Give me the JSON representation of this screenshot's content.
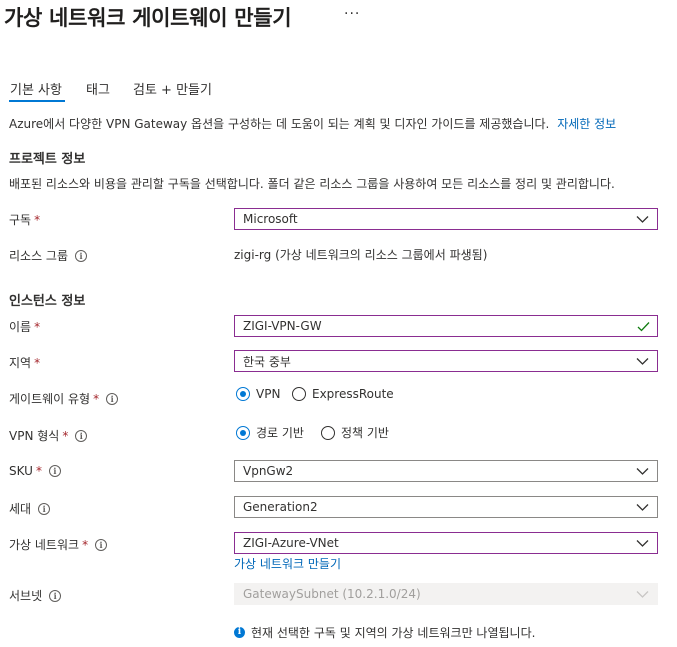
{
  "page": {
    "title": "가상 네트워크 게이트웨이 만들기",
    "more": "···"
  },
  "tabs": [
    {
      "label": "기본 사항",
      "selected": true
    },
    {
      "label": "태그",
      "selected": false
    },
    {
      "label": "검토 + 만들기",
      "selected": false
    }
  ],
  "description": {
    "text": "Azure에서 다양한 VPN Gateway 옵션을 구성하는 데 도움이 되는 계획 및 디자인 가이드를 제공했습니다.",
    "link": "자세한 정보"
  },
  "project": {
    "heading": "프로젝트 정보",
    "description": "배포된 리소스와 비용을 관리할 구독을 선택합니다. 폴더 같은 리소스 그룹을 사용하여 모든 리소스를 정리 및 관리합니다.",
    "subscription": {
      "label": "구독",
      "value": "Microsoft"
    },
    "resource_group": {
      "label": "리소스 그룹",
      "value": "zigi-rg (가상 네트워크의 리소스 그룹에서 파생됨)"
    }
  },
  "instance": {
    "heading": "인스턴스 정보",
    "name": {
      "label": "이름",
      "value": "ZIGI-VPN-GW"
    },
    "region": {
      "label": "지역",
      "value": "한국 중부"
    },
    "gateway_type": {
      "label": "게이트웨이 유형",
      "options": [
        "VPN",
        "ExpressRoute"
      ],
      "selected": "VPN"
    },
    "vpn_type": {
      "label": "VPN 형식",
      "options": [
        "경로 기반",
        "정책 기반"
      ],
      "selected": "경로 기반"
    },
    "sku": {
      "label": "SKU",
      "value": "VpnGw2"
    },
    "generation": {
      "label": "세대",
      "value": "Generation2"
    },
    "vnet": {
      "label": "가상 네트워크",
      "value": "ZIGI-Azure-VNet",
      "create_link": "가상 네트워크 만들기"
    },
    "subnet": {
      "label": "서브넷",
      "value": "GatewaySubnet (10.2.1.0/24)"
    },
    "note": "현재 선택한 구독 및 지역의 가상 네트워크만 나열됩니다."
  },
  "required_marker": "*",
  "colors": {
    "accent": "#0078d4",
    "focus_border": "#8a2d91",
    "required": "#a4262c",
    "valid": "#107c10"
  },
  "icons": {
    "info": "info-icon",
    "chevron": "chevron-down-icon",
    "check": "checkmark-icon"
  }
}
